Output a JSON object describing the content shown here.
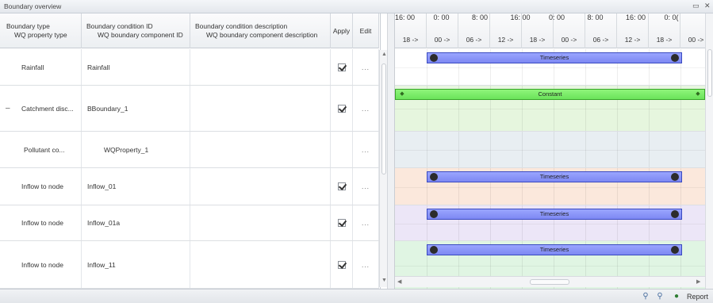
{
  "window": {
    "title": "Boundary overview",
    "restore_glyph": "▭",
    "close_glyph": "✕"
  },
  "grid": {
    "headers": {
      "type": [
        "Boundary type",
        "WQ property type"
      ],
      "id": [
        "Boundary condition ID",
        "WQ boundary component ID"
      ],
      "desc": [
        "Boundary condition description",
        "WQ boundary component description"
      ],
      "apply": "Apply",
      "edit": "Edit"
    },
    "expander": "–",
    "ellipsis": "...",
    "rows": [
      {
        "type": "Rainfall",
        "id": "Rainfall",
        "desc": "",
        "apply": true,
        "child": false
      },
      {
        "type": "Catchment disc...",
        "id": "BBoundary_1",
        "desc": "",
        "apply": true,
        "child": false,
        "expanded": true
      },
      {
        "type": "Pollutant co...",
        "id": "WQProperty_1",
        "desc": "",
        "apply": false,
        "child": true
      },
      {
        "type": "Inflow to node",
        "id": "Inflow_01",
        "desc": "",
        "apply": true,
        "child": false
      },
      {
        "type": "Inflow to node",
        "id": "Inflow_01a",
        "desc": "",
        "apply": true,
        "child": false
      },
      {
        "type": "Inflow to node",
        "id": "Inflow_11",
        "desc": "",
        "apply": true,
        "child": false
      }
    ]
  },
  "timeline": {
    "top_labels": [
      "16: 00",
      "0: 00",
      "8: 00",
      "16: 00",
      "0: 00",
      "8: 00",
      "16: 00",
      "0: 0("
    ],
    "bottom_labels": [
      "18 ->",
      "00 ->",
      "06 ->",
      "12 ->",
      "18 ->",
      "00 ->",
      "06 ->",
      "12 ->",
      "18 ->",
      "00 ->"
    ],
    "lanes": [
      {
        "color": "#ffffff",
        "bar": "Timeseries",
        "kind": "timeseries"
      },
      {
        "color": "#e6f6de",
        "bar": "Constant",
        "kind": "constant"
      },
      {
        "color": "#e8eef2",
        "bar": "",
        "kind": "none"
      },
      {
        "color": "#fbe8dc",
        "bar": "Timeseries",
        "kind": "timeseries"
      },
      {
        "color": "#ece6f7",
        "bar": "Timeseries",
        "kind": "timeseries"
      },
      {
        "color": "#e0f5e3",
        "bar": "Timeseries",
        "kind": "timeseries"
      }
    ]
  },
  "statusbar": {
    "report_label": "Report"
  },
  "icons": [
    "expand-icon",
    "ellipsis-icon",
    "checkbox-icon",
    "scroll-up-icon",
    "scroll-down-icon",
    "scroll-left-icon",
    "scroll-right-icon",
    "zoom-in-icon",
    "zoom-out-icon",
    "globe-icon"
  ]
}
